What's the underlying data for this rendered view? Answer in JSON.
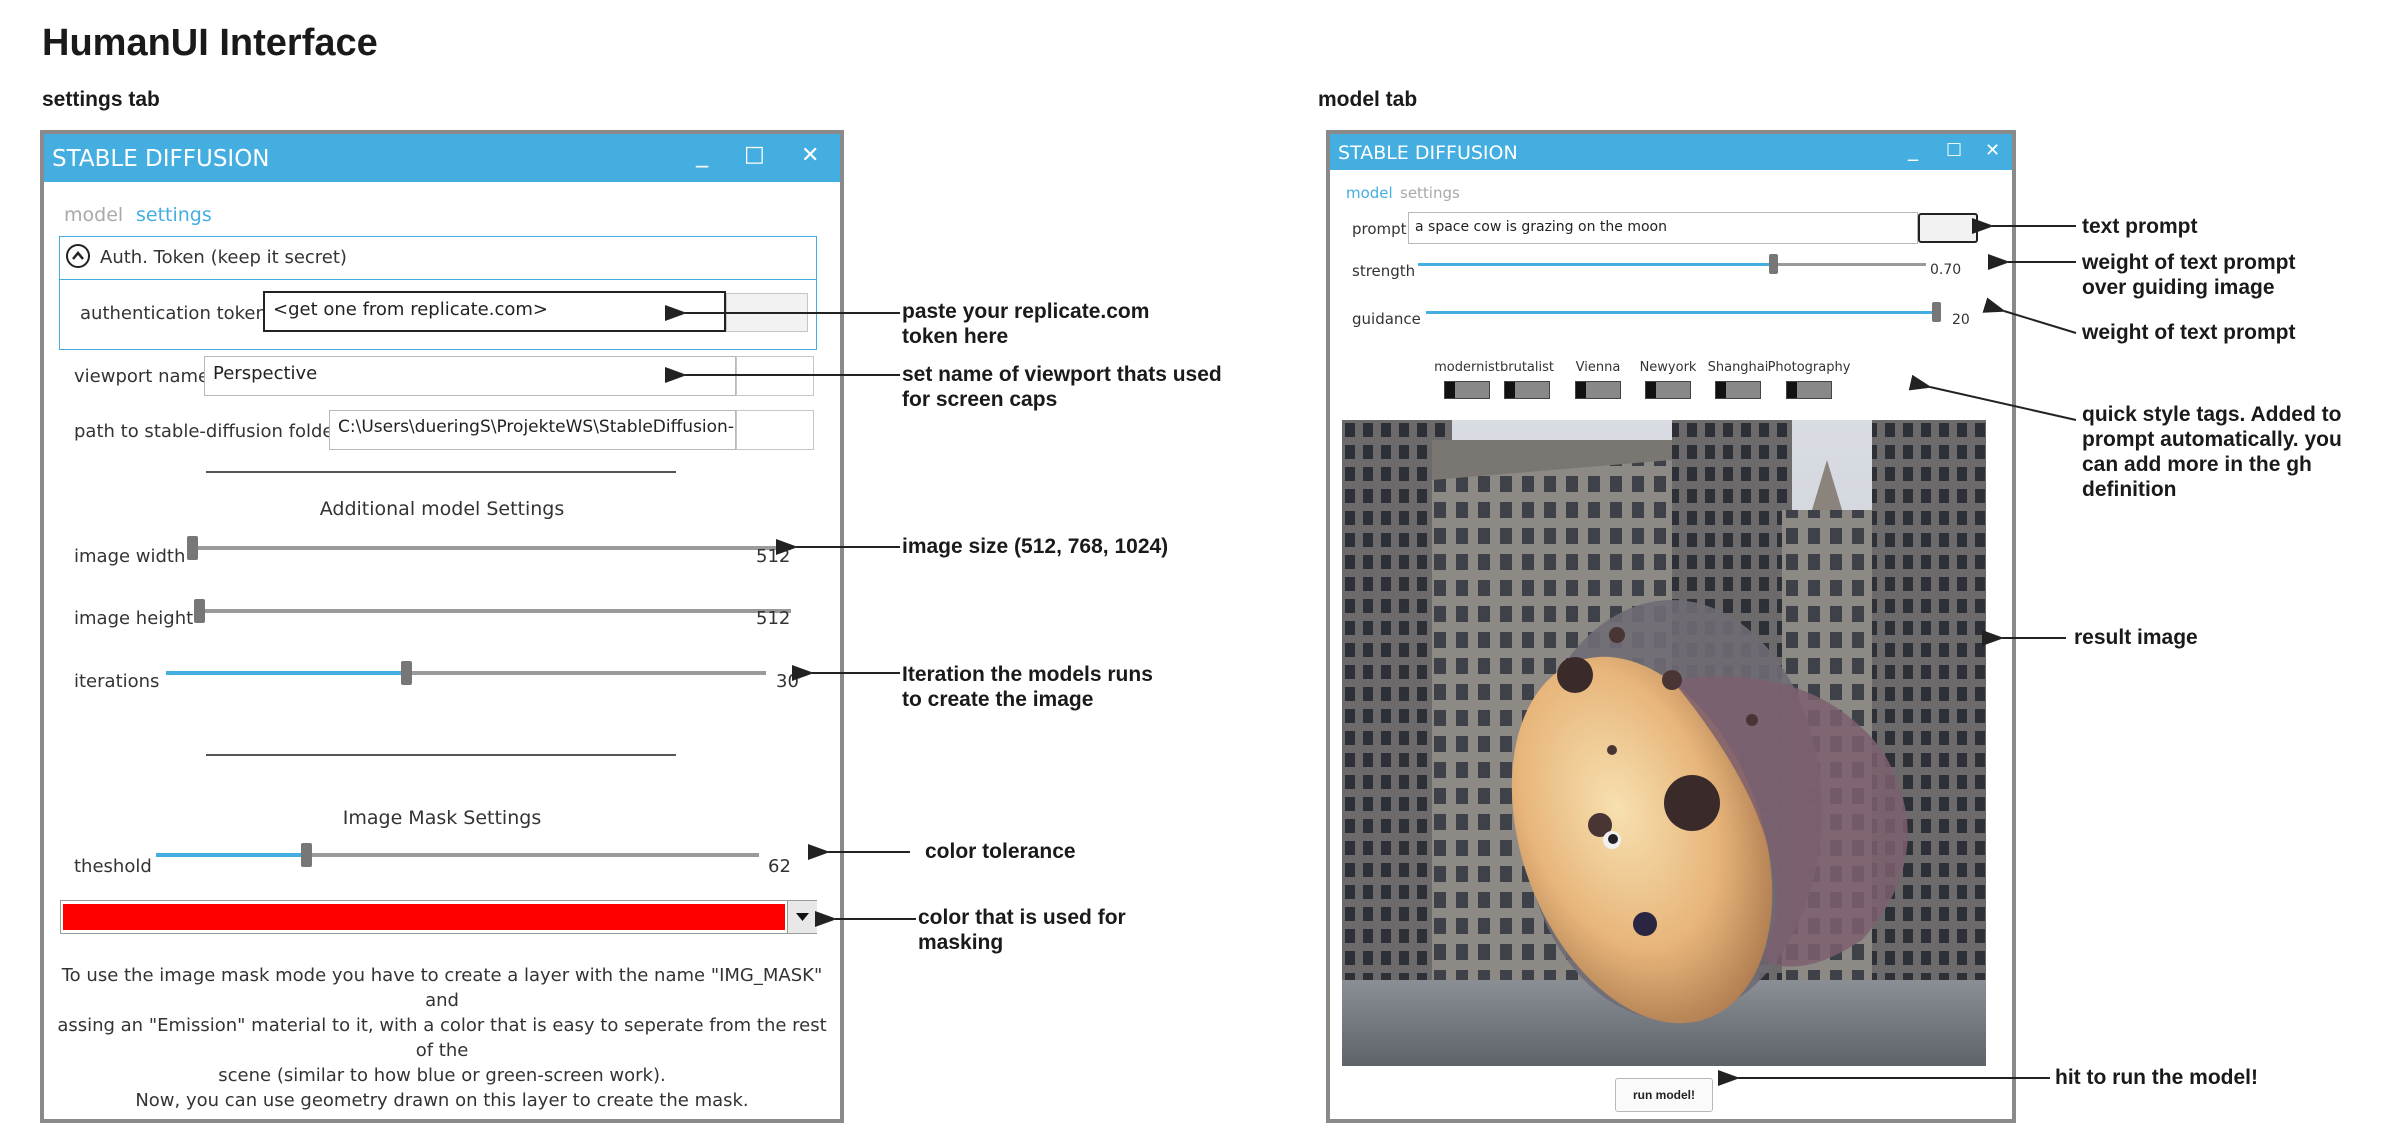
{
  "page": {
    "title": "HumanUI Interface"
  },
  "sections": {
    "settings_label": "settings tab",
    "model_label": "model tab"
  },
  "window_title": "STABLE DIFFUSION",
  "window_controls": {
    "minimize": "_",
    "maximize": "□",
    "close": "✕"
  },
  "settings_tab": {
    "tabs": [
      "model",
      "settings"
    ],
    "auth": {
      "header": "Auth. Token (keep it secret)",
      "token_label": "authentication token",
      "token_value": "<get one from replicate.com>"
    },
    "viewport": {
      "label": "viewport name",
      "value": "Perspective"
    },
    "path": {
      "label": "path to stable-diffusion folder",
      "value": "C:\\Users\\dueringS\\ProjekteWS\\StableDiffusion-"
    },
    "additional_heading": "Additional model Settings",
    "sliders": [
      {
        "label": "image width",
        "value": "512",
        "fraction": 0.0
      },
      {
        "label": "image height",
        "value": "512",
        "fraction": 0.0
      },
      {
        "label": "iterations",
        "value": "30",
        "fraction": 0.4
      }
    ],
    "mask_heading": "Image Mask Settings",
    "threshold": {
      "label": "theshold",
      "value": "62",
      "fraction": 0.25
    },
    "mask_color": "#ff0000",
    "mask_help": [
      "To use the image mask mode you have to create a layer with the name \"IMG_MASK\" and",
      "assing an \"Emission\" material to it, with a color that is easy to seperate from the rest of the",
      "scene (similar to how blue or green-screen work).",
      "Now, you can use geometry drawn on this layer to create the mask."
    ]
  },
  "model_tab": {
    "tabs": [
      "model",
      "settings"
    ],
    "prompt": {
      "label": "prompt",
      "value": "a space cow is grazing on the moon"
    },
    "strength": {
      "label": "strength",
      "value": "0.70",
      "fraction": 0.7
    },
    "guidance": {
      "label": "guidance",
      "value": "20",
      "fraction": 1.0
    },
    "style_tags": [
      "modernist",
      "brutalist",
      "Vienna",
      "Newyork",
      "Shanghai",
      "Photography"
    ],
    "run_button": "run model!"
  },
  "annotations": {
    "token": [
      "paste your replicate.com",
      "token here"
    ],
    "viewport": [
      "set name of viewport thats used",
      "for screen caps"
    ],
    "image_size": [
      "image size (512, 768, 1024)"
    ],
    "iterations": [
      "Iteration the models runs",
      "to create the image"
    ],
    "tolerance": [
      "color tolerance"
    ],
    "mask_color": [
      "color that is used for",
      "masking"
    ],
    "text_prompt": [
      "text prompt"
    ],
    "strength": [
      "weight of text prompt",
      "over guiding image"
    ],
    "guidance": [
      "weight of text prompt"
    ],
    "tags": [
      "quick style tags. Added to",
      "prompt automatically. you",
      "can add more in the gh",
      "definition"
    ],
    "result": [
      "result image"
    ],
    "run": [
      "hit to run the model!"
    ]
  }
}
